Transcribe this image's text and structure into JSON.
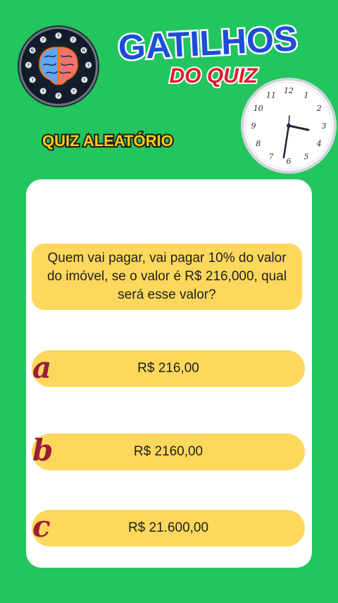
{
  "header": {
    "title": "GATILHOS",
    "subtitle": "DO QUIZ",
    "category": "QUIZ ALEATÓRIO"
  },
  "logo": {
    "icon": "brain-icon"
  },
  "clock": {
    "icon": "clock-icon",
    "numerals": [
      "12",
      "1",
      "2",
      "3",
      "4",
      "5",
      "6",
      "7",
      "8",
      "9",
      "10",
      "11"
    ]
  },
  "quiz": {
    "question": "Quem vai pagar, vai pagar 10% do valor do imóvel, se o valor é R$ 216,000, qual será esse valor?",
    "options": [
      {
        "letter": "a",
        "text": "R$ 216,00"
      },
      {
        "letter": "b",
        "text": "R$ 2160,00"
      },
      {
        "letter": "c",
        "text": "R$ 21.600,00"
      }
    ]
  },
  "colors": {
    "background": "#22c55e",
    "card": "#ffffff",
    "answer_fill": "#fdd85d",
    "letter": "#9d1c3a",
    "title_blue": "#1d4ed8",
    "subtitle_red": "#e11d2e",
    "category_yellow": "#facc15"
  }
}
